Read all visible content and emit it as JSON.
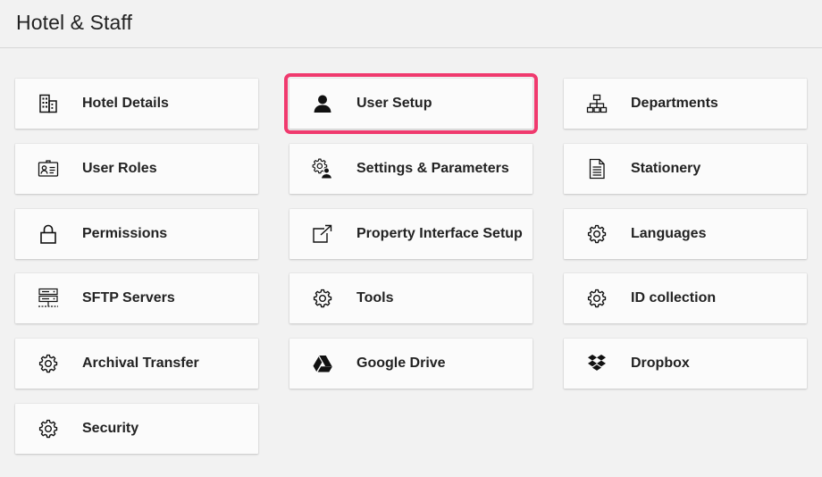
{
  "page": {
    "title": "Hotel & Staff"
  },
  "tiles": {
    "hotel_details": {
      "label": "Hotel Details",
      "icon": "building-icon"
    },
    "user_setup": {
      "label": "User Setup",
      "icon": "user-icon",
      "highlighted": true,
      "highlight_color": "#f03a6e"
    },
    "departments": {
      "label": "Departments",
      "icon": "org-chart-icon"
    },
    "user_roles": {
      "label": "User Roles",
      "icon": "id-card-icon"
    },
    "settings_parameters": {
      "label": "Settings & Parameters",
      "icon": "user-gear-icon"
    },
    "stationery": {
      "label": "Stationery",
      "icon": "document-icon"
    },
    "permissions": {
      "label": "Permissions",
      "icon": "lock-icon"
    },
    "property_interface_setup": {
      "label": "Property Interface Setup",
      "icon": "external-link-icon"
    },
    "languages": {
      "label": "Languages",
      "icon": "gear-icon"
    },
    "sftp_servers": {
      "label": "SFTP Servers",
      "icon": "server-icon"
    },
    "tools": {
      "label": "Tools",
      "icon": "gear-icon"
    },
    "id_collection": {
      "label": "ID collection",
      "icon": "gear-icon"
    },
    "archival_transfer": {
      "label": "Archival Transfer",
      "icon": "gear-icon"
    },
    "google_drive": {
      "label": "Google Drive",
      "icon": "google-drive-icon"
    },
    "dropbox": {
      "label": "Dropbox",
      "icon": "dropbox-icon"
    },
    "security": {
      "label": "Security",
      "icon": "gear-icon"
    }
  }
}
